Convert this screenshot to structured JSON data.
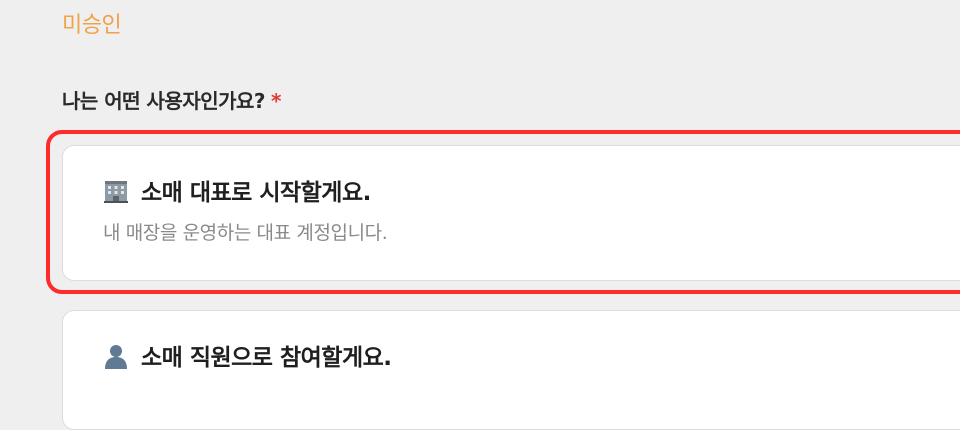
{
  "status_label": "미승인",
  "question": {
    "label": "나는 어떤 사용자인가요?",
    "required_mark": "*"
  },
  "options": [
    {
      "icon": "office-building-icon",
      "title": "소매 대표로 시작할게요.",
      "description": "내 매장을 운영하는 대표 계정입니다.",
      "selected": true
    },
    {
      "icon": "person-silhouette-icon",
      "title": "소매 직원으로 참여할게요.",
      "selected": false
    }
  ],
  "colors": {
    "status": "#f0a24a",
    "required": "#e53935",
    "selection_ring": "#ff2a2a",
    "background": "#efefef"
  }
}
